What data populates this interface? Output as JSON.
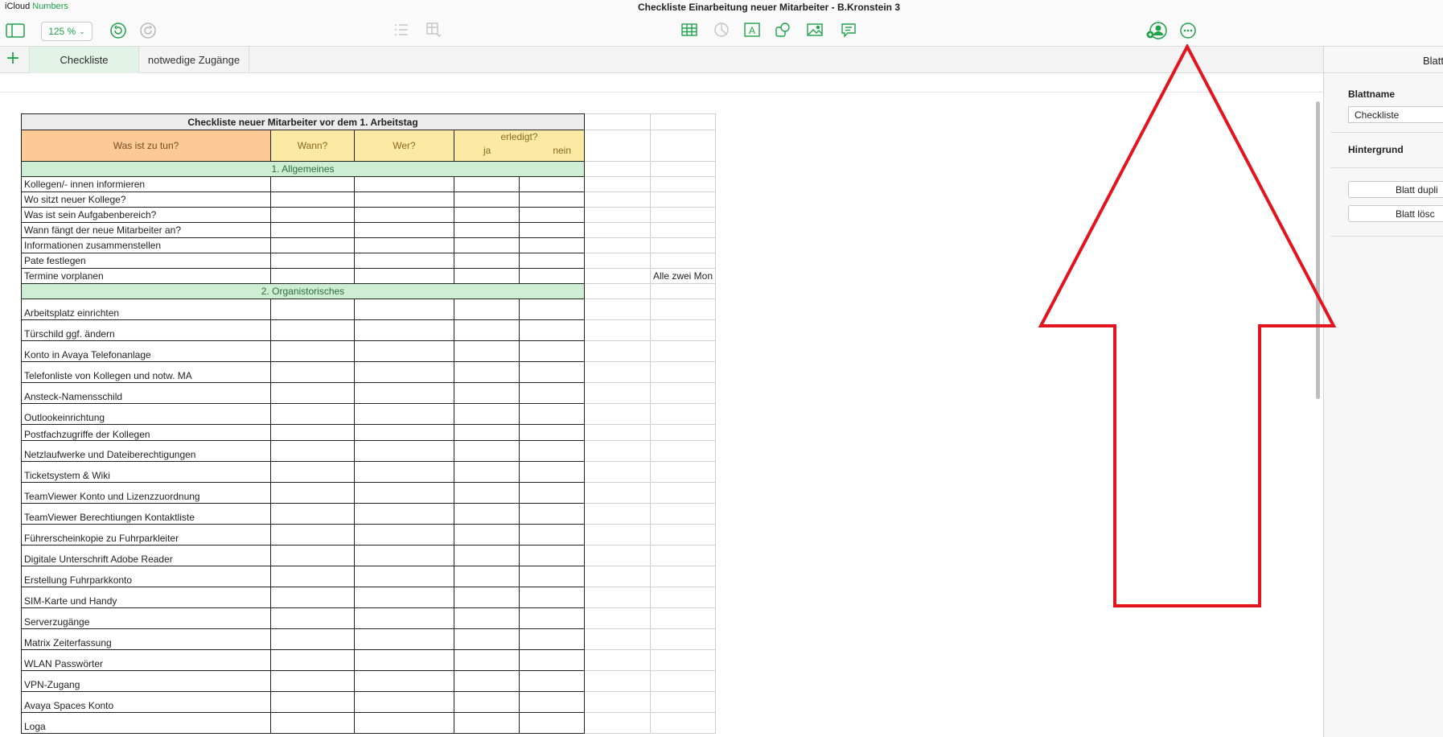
{
  "app": {
    "brand_left": "iCloud",
    "brand_right": "Numbers",
    "doc_title": "Checkliste Einarbeitung neuer Mitarbeiter - B.Kronstein 3"
  },
  "toolbar": {
    "zoom": "125 %",
    "icons": [
      "sidebar-icon",
      "undo-icon",
      "redo-icon",
      "list-icon",
      "table-format-icon",
      "table-icon",
      "chart-icon",
      "text-icon",
      "shape-icon",
      "media-icon",
      "comment-icon",
      "collaborate-icon",
      "more-icon"
    ]
  },
  "tabs": [
    {
      "label": "Checkliste",
      "active": true
    },
    {
      "label": "notwedige Zugänge",
      "active": false
    }
  ],
  "panel": {
    "header": "Blatt",
    "sheet_name_label": "Blattname",
    "sheet_name_value": "Checkliste",
    "background_label": "Hintergrund",
    "duplicate_button": "Blatt dupli",
    "delete_button": "Blatt lösc"
  },
  "sheet": {
    "title": "Checkliste neuer Mitarbeiter vor dem 1. Arbeitstag",
    "headers": {
      "what": "Was ist zu tun?",
      "when": "Wann?",
      "who": "Wer?",
      "done": "erledigt?",
      "yes": "ja",
      "no": "nein"
    },
    "section1": "1. Allgemeines",
    "section1_rows": [
      "Kollegen/- innen informieren",
      "Wo sitzt neuer Kollege?",
      "Was ist sein Aufgabenbereich?",
      "Wann fängt der neue Mitarbeiter an?",
      "Informationen zusammenstellen",
      "Pate festlegen",
      "Termine vorplanen"
    ],
    "side_note": "Alle zwei Mon",
    "section2": "2. Organistorisches",
    "section2_rows": [
      "Arbeitsplatz einrichten",
      "Türschild ggf. ändern",
      "Konto in Avaya Telefonanlage",
      "Telefonliste von Kollegen und notw. MA",
      "Ansteck-Namensschild",
      "Outlookeinrichtung",
      "Postfachzugriffe der Kollegen",
      "Netzlaufwerke und Dateiberechtigungen",
      "Ticketsystem & Wiki",
      "TeamViewer Konto und Lizenzzuordnung",
      "TeamViewer Berechtiungen Kontaktliste",
      "Führerscheinkopie zu Fuhrparkleiter",
      "Digitale Unterschrift Adobe Reader",
      "Erstellung Fuhrparkkonto",
      "SIM-Karte und Handy",
      "Serverzugänge",
      "Matrix Zeiterfassung",
      "WLAN Passwörter",
      "VPN-Zugang",
      "Avaya Spaces Konto",
      "Loga"
    ]
  },
  "colors": {
    "accent": "#1fa24a",
    "arrow": "#e3141e",
    "header_orange": "#fdc997",
    "header_yellow": "#fce9a3",
    "section_green": "#cdeed3"
  }
}
